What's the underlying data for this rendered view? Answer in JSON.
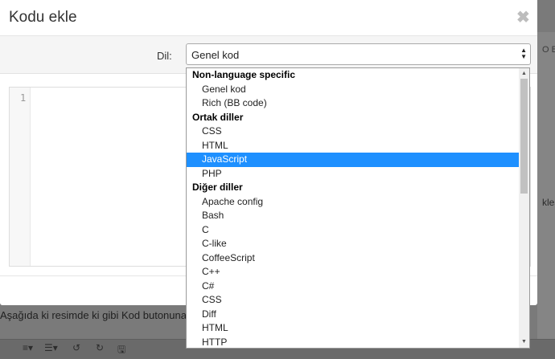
{
  "modal": {
    "title": "Kodu ekle",
    "close_symbol": "✖",
    "language_label": "Dil:",
    "language_value": "Genel kod",
    "line_number": "1"
  },
  "dropdown": {
    "selected": "JavaScript",
    "items": [
      {
        "type": "group",
        "label": "Non-language specific"
      },
      {
        "type": "option",
        "label": "Genel kod"
      },
      {
        "type": "option",
        "label": "Rich (BB code)"
      },
      {
        "type": "group",
        "label": "Ortak diller"
      },
      {
        "type": "option",
        "label": "CSS"
      },
      {
        "type": "option",
        "label": "HTML"
      },
      {
        "type": "option",
        "label": "JavaScript"
      },
      {
        "type": "option",
        "label": "PHP"
      },
      {
        "type": "group",
        "label": "Diğer diller"
      },
      {
        "type": "option",
        "label": "Apache config"
      },
      {
        "type": "option",
        "label": "Bash"
      },
      {
        "type": "option",
        "label": "C"
      },
      {
        "type": "option",
        "label": "C-like"
      },
      {
        "type": "option",
        "label": "CoffeeScript"
      },
      {
        "type": "option",
        "label": "C++"
      },
      {
        "type": "option",
        "label": "C#"
      },
      {
        "type": "option",
        "label": "CSS"
      },
      {
        "type": "option",
        "label": "Diff"
      },
      {
        "type": "option",
        "label": "HTML"
      },
      {
        "type": "option",
        "label": "HTTP"
      }
    ]
  },
  "background": {
    "right_text_1": "O Beğ",
    "right_text_2": "kleş",
    "left_text": "Aşağıda ki resimde ki gibi Kod butonuna ba",
    "toolbar_icons": [
      "≡▾",
      "☰▾",
      "↺",
      "↻",
      "🖫"
    ]
  },
  "colors": {
    "selected_bg": "#1e90ff",
    "overlay": "#7a7a7a"
  }
}
